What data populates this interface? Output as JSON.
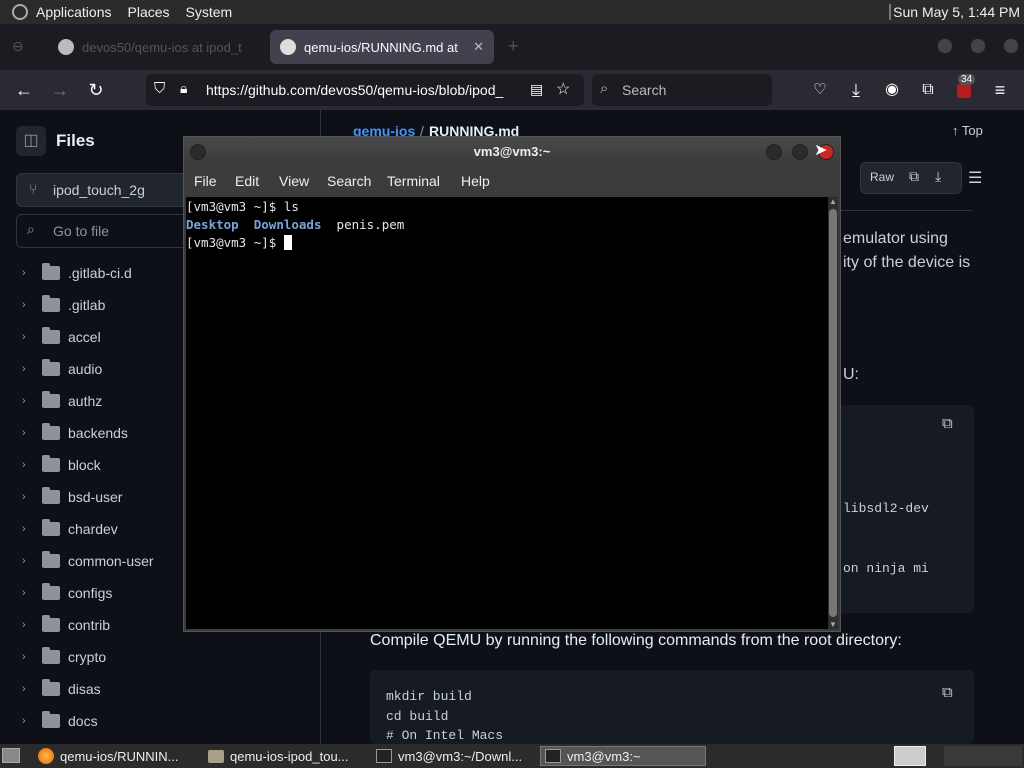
{
  "topbar": {
    "menus": [
      "Applications",
      "Places",
      "System"
    ],
    "clock": "Sun May 5,  1:44 PM"
  },
  "browser": {
    "tabs": [
      {
        "label": "devos50/qemu-ios at ipod_t"
      },
      {
        "label": "qemu-ios/RUNNING.md at"
      }
    ],
    "url": "https://github.com/devos50/qemu-ios/blob/ipod_",
    "search_placeholder": "Search",
    "extension_badge": "34"
  },
  "github": {
    "sidebar_title": "Files",
    "branch": "ipod_touch_2g",
    "goto_placeholder": "Go to file",
    "files": [
      ".gitlab-ci.d",
      ".gitlab",
      "accel",
      "audio",
      "authz",
      "backends",
      "block",
      "bsd-user",
      "chardev",
      "common-user",
      "configs",
      "contrib",
      "crypto",
      "disas",
      "docs"
    ],
    "breadcrumb_repo": "qemu-ios",
    "breadcrumb_sep": "/",
    "breadcrumb_file": "RUNNING.md",
    "top_label": "Top",
    "raw_label": "Raw",
    "text_frag1": "emulator using",
    "text_frag2": "ity of the device is",
    "text_frag3": "U:",
    "code_frag1": "libsdl2-dev",
    "code_frag2": "on ninja mi",
    "compile_text": "Compile QEMU by running the following commands from the root directory:",
    "code_lines": [
      "mkdir build",
      "cd build",
      "# On Intel Macs"
    ]
  },
  "terminal": {
    "title": "vm3@vm3:~",
    "menu": [
      "File",
      "Edit",
      "View",
      "Search",
      "Terminal",
      "Help"
    ],
    "prompt": "[vm3@vm3 ~]$ ",
    "command": "ls",
    "ls_dir1": "Desktop",
    "ls_dir2": "Downloads",
    "ls_file": "penis.pem",
    "dir_color": "#7aa3d9"
  },
  "taskbar": {
    "tasks": [
      "qemu-ios/RUNNIN...",
      "qemu-ios-ipod_tou...",
      "vm3@vm3:~/Downl...",
      "vm3@vm3:~"
    ]
  }
}
